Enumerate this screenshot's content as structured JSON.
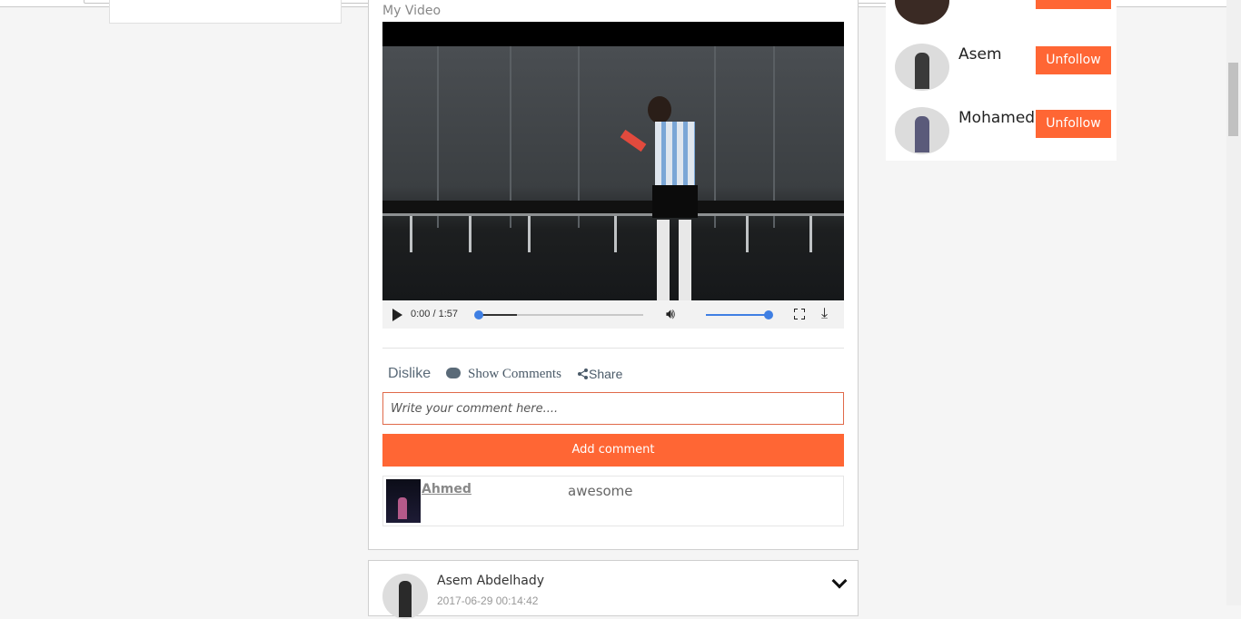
{
  "video": {
    "title": "My Video",
    "time": "0:00 / 1:57",
    "progress_fraction": 0.0,
    "volume_fraction": 1.0
  },
  "actions": {
    "dislike_label": "Dislike",
    "comments_label": "Show Comments",
    "share_label": "Share"
  },
  "comment_form": {
    "placeholder": "Write your comment here....",
    "submit_label": "Add comment"
  },
  "comments": [
    {
      "author": "Ahmed",
      "text": "awesome"
    }
  ],
  "next_post": {
    "author": "Asem Abdelhady",
    "date": "2017-06-29 00:14:42"
  },
  "following": [
    {
      "name": "Asem",
      "button_label": "Unfollow"
    },
    {
      "name": "Mohamed",
      "button_label": "Unfollow"
    }
  ],
  "colors": {
    "accent": "#ff6634",
    "progress": "#3f7fe3"
  }
}
